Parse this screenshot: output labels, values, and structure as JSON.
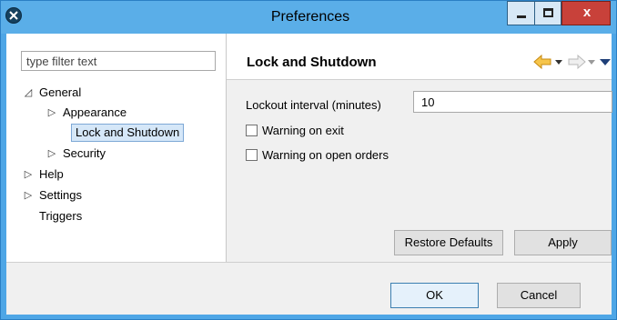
{
  "window": {
    "title": "Preferences",
    "close_label": "x"
  },
  "sidebar": {
    "filter_placeholder": "type filter text",
    "tree": [
      {
        "label": "General",
        "expanded": true,
        "level": 0
      },
      {
        "label": "Appearance",
        "expanded": false,
        "level": 1
      },
      {
        "label": "Lock and Shutdown",
        "selected": true,
        "level": 1
      },
      {
        "label": "Security",
        "expanded": false,
        "level": 1
      },
      {
        "label": "Help",
        "expanded": false,
        "level": 0
      },
      {
        "label": "Settings",
        "expanded": false,
        "level": 0
      },
      {
        "label": "Triggers",
        "level": 0
      }
    ]
  },
  "page": {
    "title": "Lock and Shutdown",
    "lockout_label": "Lockout interval (minutes)",
    "lockout_value": "10",
    "warning_exit_label": "Warning on exit",
    "warning_exit_checked": false,
    "warning_orders_label": "Warning on open orders",
    "warning_orders_checked": false,
    "restore_label": "Restore Defaults",
    "apply_label": "Apply"
  },
  "dialog": {
    "ok_label": "OK",
    "cancel_label": "Cancel"
  },
  "colors": {
    "title_bar": "#5aaee8",
    "close_button": "#c8413a",
    "selection": "#d5e7f8",
    "back_arrow": "#e8a823"
  },
  "icons": {
    "app": "eclipse-icon",
    "back": "back-arrow-icon",
    "forward": "forward-arrow-icon",
    "menu": "view-menu-icon"
  }
}
